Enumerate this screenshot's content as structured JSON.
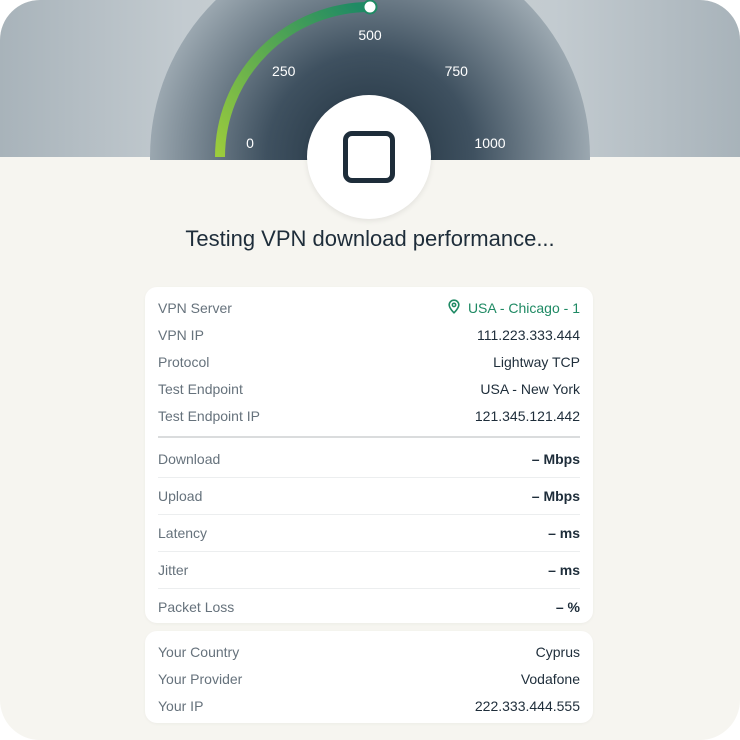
{
  "gauge": {
    "ticks": [
      "0",
      "250",
      "500",
      "750",
      "1000"
    ],
    "progress_fraction": 0.5,
    "colors": {
      "start": "#9ccc3c",
      "end": "#1f8a64",
      "track": "#3e5060"
    }
  },
  "stop_button": {
    "icon": "stop-square-icon"
  },
  "headline": "Testing VPN download performance...",
  "connection": [
    {
      "label": "VPN Server",
      "value": "USA - Chicago - 1",
      "icon": "location-pin-icon"
    },
    {
      "label": "VPN IP",
      "value": "111.223.333.444"
    },
    {
      "label": "Protocol",
      "value": "Lightway TCP"
    },
    {
      "label": "Test Endpoint",
      "value": "USA - New York"
    },
    {
      "label": "Test Endpoint IP",
      "value": "121.345.121.442"
    }
  ],
  "metrics": [
    {
      "label": "Download",
      "value": "– Mbps"
    },
    {
      "label": "Upload",
      "value": "– Mbps"
    },
    {
      "label": "Latency",
      "value": "– ms"
    },
    {
      "label": "Jitter",
      "value": "– ms"
    },
    {
      "label": "Packet Loss",
      "value": "– %"
    }
  ],
  "user": [
    {
      "label": "Your Country",
      "value": "Cyprus"
    },
    {
      "label": "Your Provider",
      "value": "Vodafone"
    },
    {
      "label": "Your IP",
      "value": "222.333.444.555"
    }
  ]
}
